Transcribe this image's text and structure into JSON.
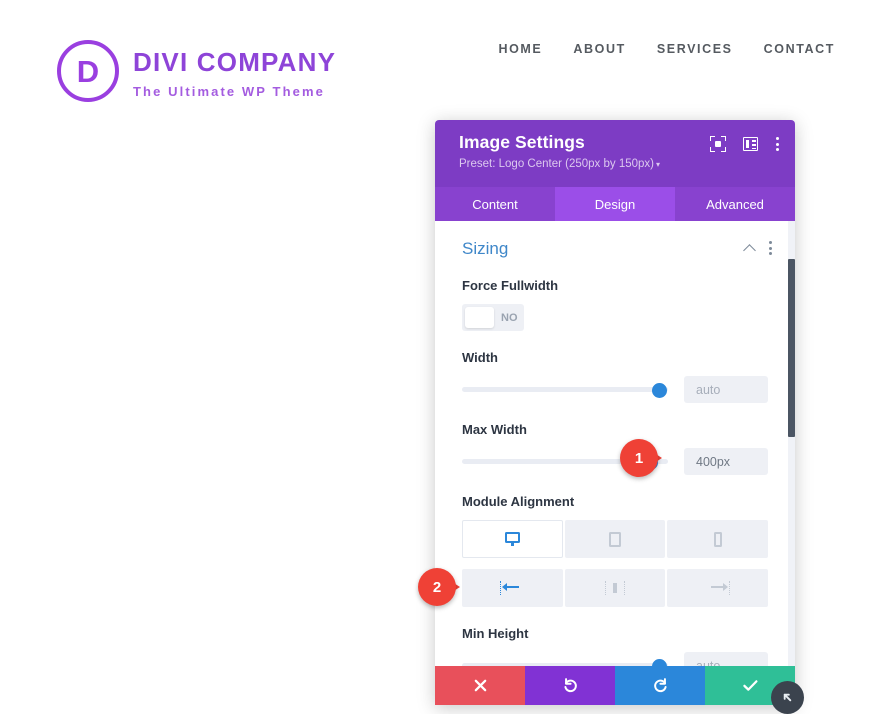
{
  "site": {
    "logo": {
      "mark_letter": "D",
      "title": "DIVI COMPANY",
      "tagline": "The Ultimate WP Theme",
      "brand_color": "#8e44d8"
    },
    "nav": [
      {
        "label": "HOME"
      },
      {
        "label": "ABOUT"
      },
      {
        "label": "SERVICES"
      },
      {
        "label": "CONTACT"
      }
    ]
  },
  "modal": {
    "title": "Image Settings",
    "preset": "Preset: Logo Center (250px by 150px)",
    "preset_caret": "▾",
    "header_icons": [
      {
        "name": "focus-icon"
      },
      {
        "name": "panel-layout-icon"
      },
      {
        "name": "kebab-menu-icon"
      }
    ],
    "tabs": [
      {
        "label": "Content",
        "active": false
      },
      {
        "label": "Design",
        "active": true
      },
      {
        "label": "Advanced",
        "active": false
      }
    ],
    "header_color": "#7d3cc4",
    "tab_active_color": "#9b4ee8",
    "section": {
      "title": "Sizing",
      "title_color": "#3f87c9",
      "collapse_icon": "chevron-up-icon",
      "options_icon": "kebab-menu-icon"
    },
    "fields": {
      "force_fullwidth": {
        "label": "Force Fullwidth",
        "toggle_value": "NO"
      },
      "width": {
        "label": "Width",
        "value": "",
        "placeholder": "auto",
        "slider_percent": 92
      },
      "max_width": {
        "label": "Max Width",
        "value": "400px",
        "placeholder": "400px",
        "slider_percent": 88
      },
      "module_alignment": {
        "label": "Module Alignment",
        "devices": [
          {
            "name": "desktop-icon",
            "active": true
          },
          {
            "name": "tablet-icon",
            "active": false
          },
          {
            "name": "phone-icon",
            "active": false
          }
        ],
        "alignments": [
          {
            "name": "align-left-icon",
            "active": true
          },
          {
            "name": "align-center-icon",
            "active": false
          },
          {
            "name": "align-right-icon",
            "active": false
          }
        ]
      },
      "min_height": {
        "label": "Min Height",
        "value": "",
        "placeholder": "auto",
        "slider_percent": 92
      }
    },
    "actions": [
      {
        "name": "cancel-button",
        "icon": "close-icon",
        "color": "#e8505b"
      },
      {
        "name": "undo-button",
        "icon": "undo-icon",
        "color": "#8132d4"
      },
      {
        "name": "redo-button",
        "icon": "redo-icon",
        "color": "#2b87da"
      },
      {
        "name": "save-button",
        "icon": "check-icon",
        "color": "#2fbf97"
      }
    ],
    "resize_handle_icon": "resize-arrow-icon"
  },
  "callouts": [
    {
      "number": "1",
      "color": "#ef4136"
    },
    {
      "number": "2",
      "color": "#ef4136"
    }
  ]
}
